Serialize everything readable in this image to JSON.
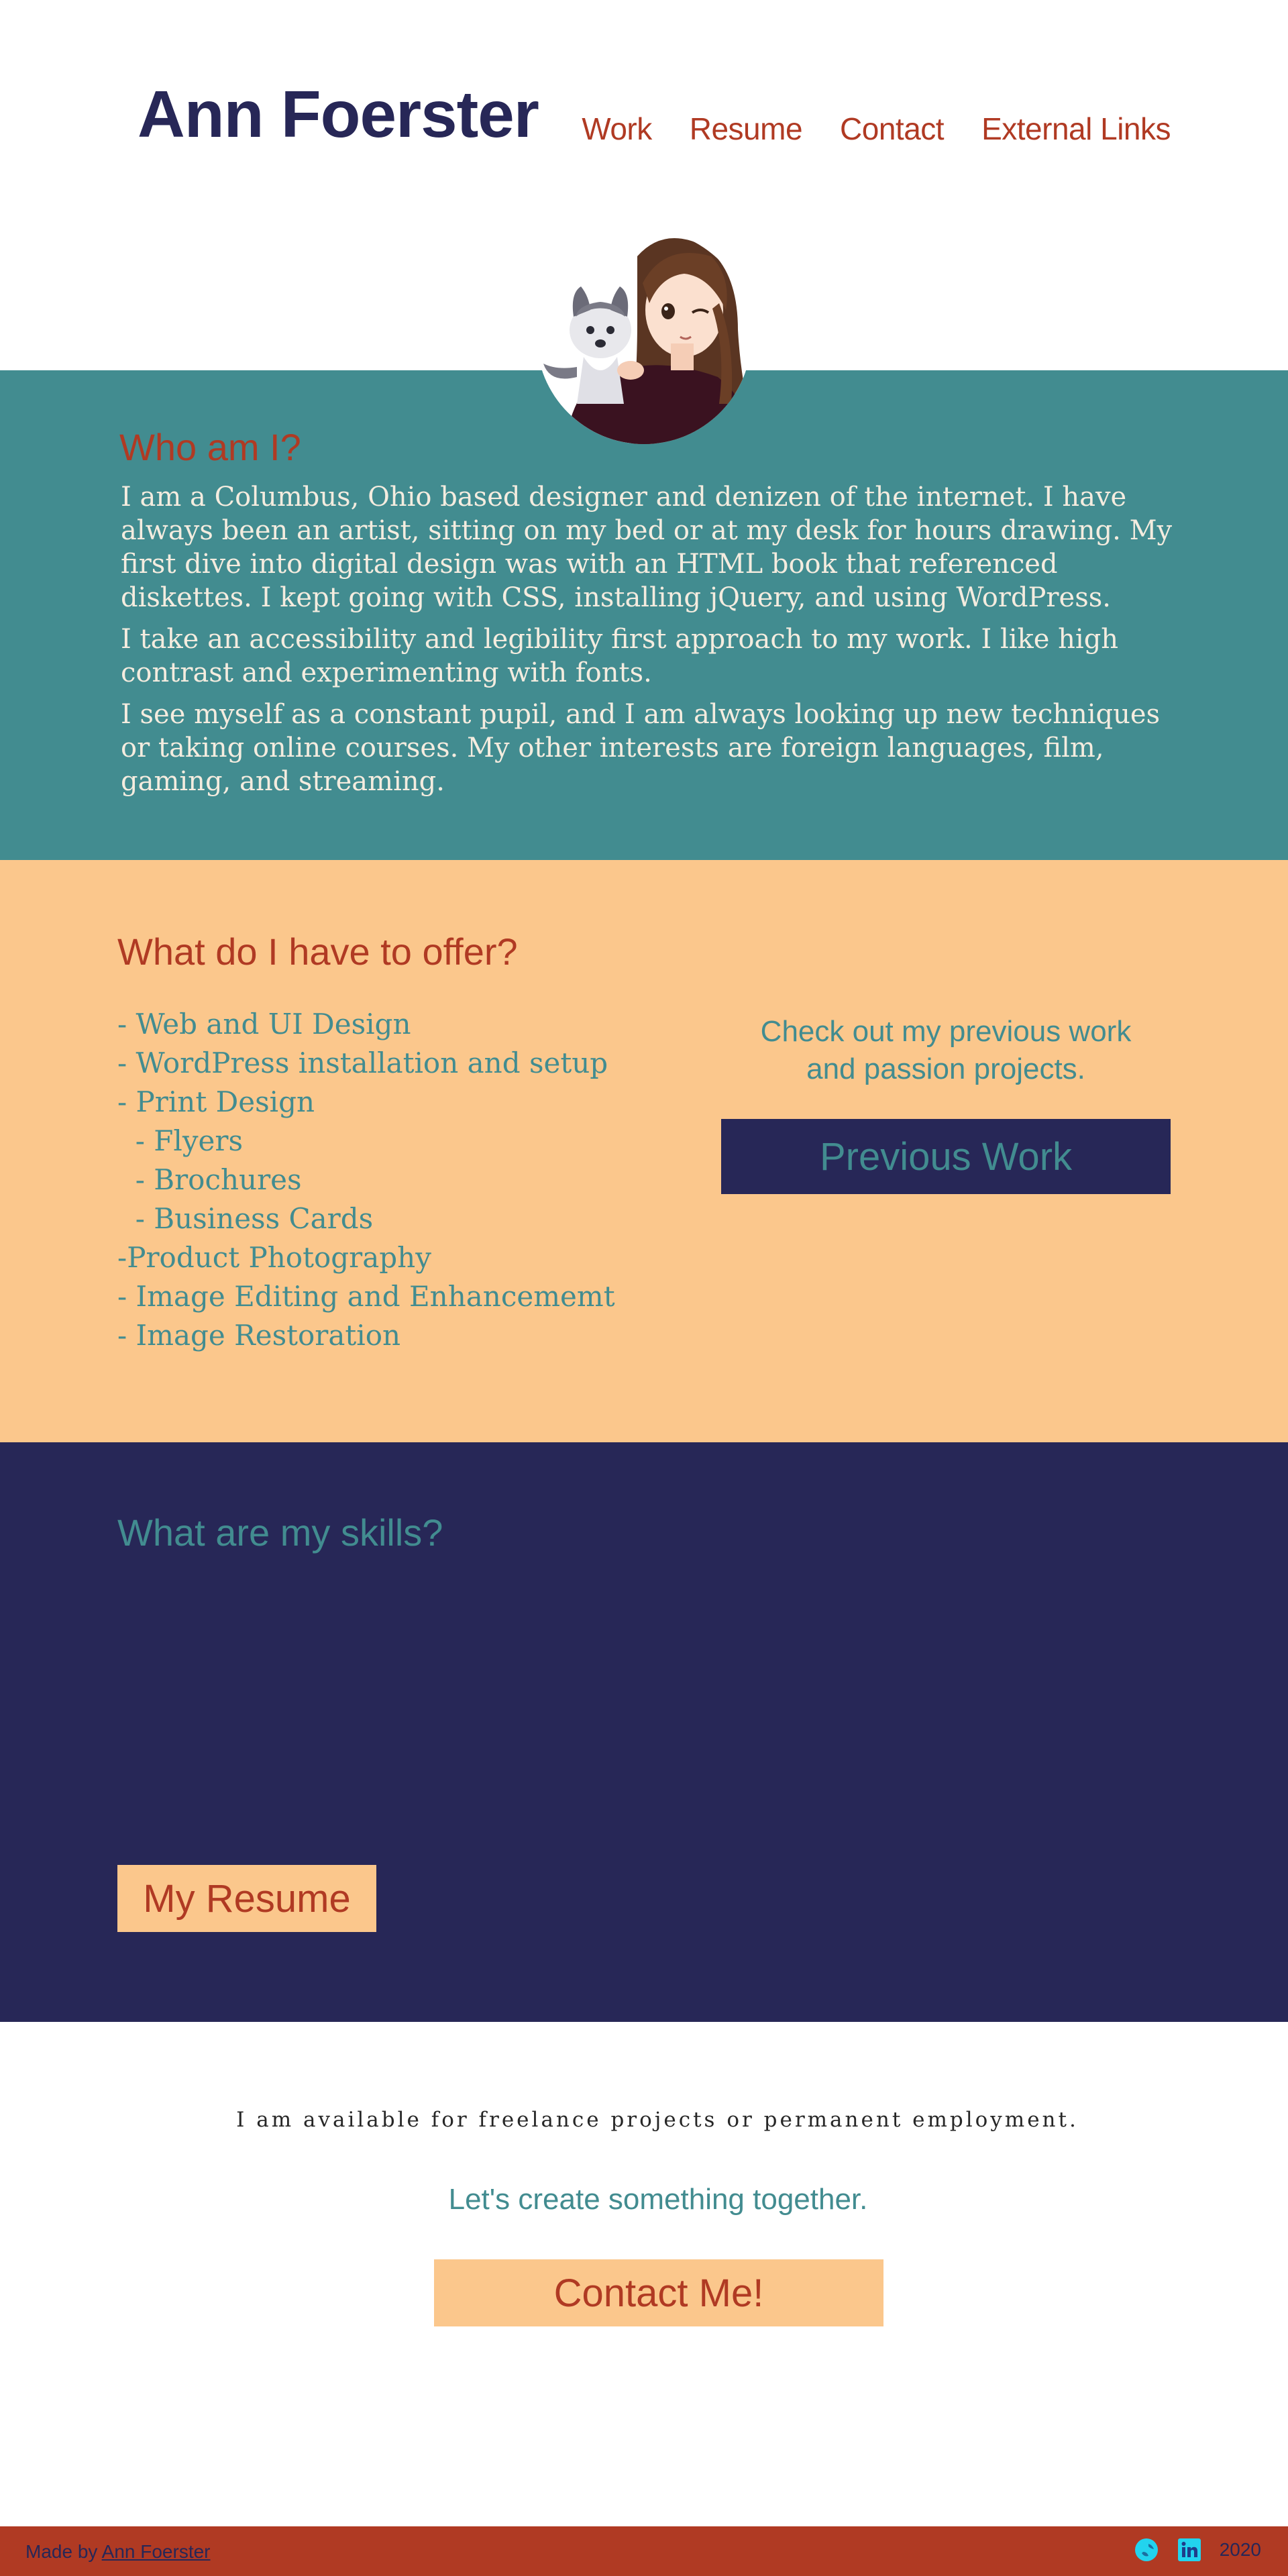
{
  "header": {
    "site_name": "Ann Foerster",
    "nav": [
      "Work",
      "Resume",
      "Contact",
      "External Links"
    ]
  },
  "avatar": {
    "alt": "Illustrated portrait of Ann winking with a husky puppy"
  },
  "who": {
    "heading": "Who am I?",
    "paragraphs": [
      "I am a Columbus, Ohio based designer and denizen of the internet.  I have always been an artist, sitting on my bed or at my desk for hours drawing.  My first dive into digital design was with an HTML book that referenced diskettes.  I kept going with CSS, installing jQuery, and using WordPress.",
      "I take an accessibility and legibility first approach to my work.  I like high contrast and experimenting with fonts.",
      "I see myself as a constant pupil, and I am always looking up new techniques or taking online courses.  My other interests are foreign languages, film, gaming, and streaming."
    ]
  },
  "offer": {
    "heading": "What do I have to offer?",
    "items": [
      "- Web and UI Design",
      "- WordPress installation and setup",
      "- Print Design",
      "  - Flyers",
      "  - Brochures",
      "  - Business Cards",
      "-Product Photography",
      "- Image Editing and Enhancememt",
      "- Image Restoration"
    ],
    "cta_line1": "Check out my previous work",
    "cta_line2": "and passion projects.",
    "button": "Previous Work"
  },
  "skills": {
    "heading": "What are my skills?",
    "button": "My Resume"
  },
  "cta": {
    "availability": "I am available for freelance projects or permanent employment.",
    "tagline": "Let's create something together.",
    "button": "Contact Me!"
  },
  "footer": {
    "made_by": "Made by",
    "author": "Ann Foerster",
    "year": "2020",
    "icons": [
      "globe-icon",
      "linkedin-icon"
    ]
  },
  "colors": {
    "navy": "#272757",
    "teal": "#428c90",
    "peach": "#fbc78c",
    "rust": "#b03a23",
    "cyan_icon": "#22d3ee"
  }
}
